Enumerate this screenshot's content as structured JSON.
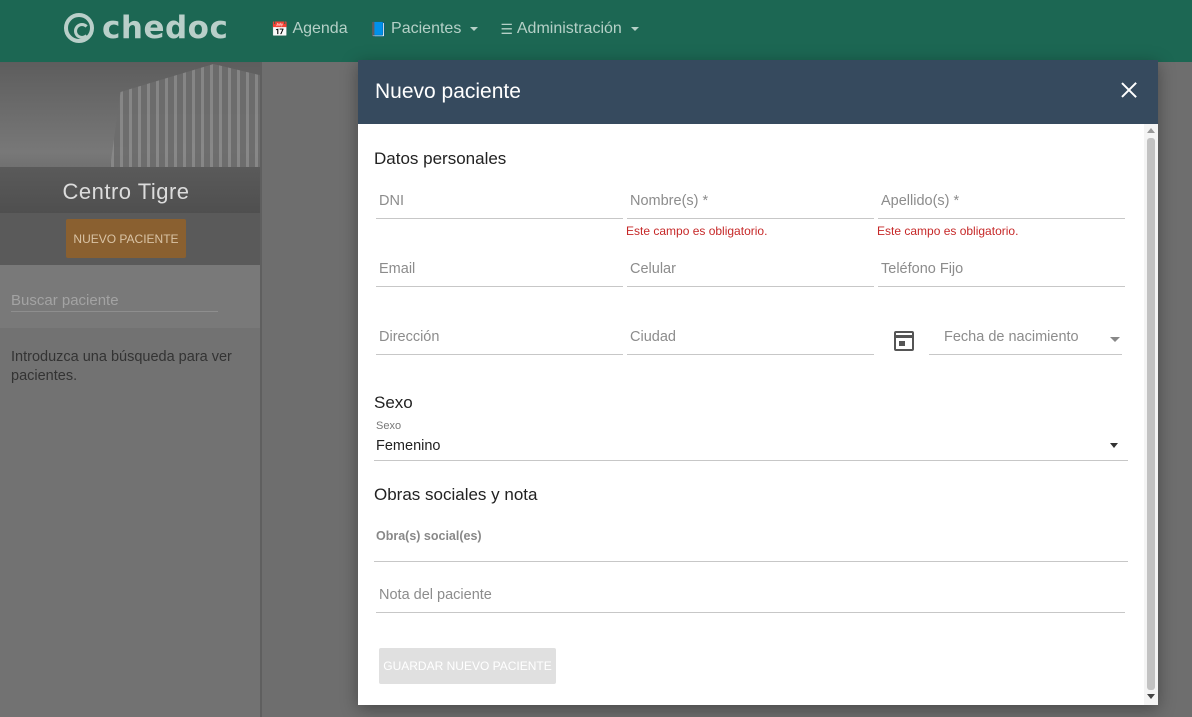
{
  "brand": {
    "name": "chedoc"
  },
  "nav": {
    "items": [
      {
        "label": "Agenda",
        "icon": "calendar-icon",
        "dropdown": false
      },
      {
        "label": "Pacientes",
        "icon": "book-icon",
        "dropdown": true
      },
      {
        "label": "Administración",
        "icon": "sliders-icon",
        "dropdown": true
      }
    ]
  },
  "sidebar": {
    "center_name": "Centro Tigre",
    "new_patient_label": "NUEVO PACIENTE",
    "search_placeholder": "Buscar paciente",
    "help_text": "Introduzca una búsqueda para ver pacientes."
  },
  "modal": {
    "title": "Nuevo paciente",
    "sections": {
      "personal": "Datos personales",
      "sex": "Sexo",
      "insurance": "Obras sociales y nota"
    },
    "fields": {
      "dni": {
        "placeholder": "DNI",
        "value": ""
      },
      "nombre": {
        "placeholder": "Nombre(s) *",
        "value": "",
        "error": "Este campo es obligatorio."
      },
      "apellido": {
        "placeholder": "Apellido(s) *",
        "value": "",
        "error": "Este campo es obligatorio."
      },
      "email": {
        "placeholder": "Email",
        "value": ""
      },
      "celular": {
        "placeholder": "Celular",
        "value": ""
      },
      "telefono": {
        "placeholder": "Teléfono Fijo",
        "value": ""
      },
      "direccion": {
        "placeholder": "Dirección",
        "value": ""
      },
      "ciudad": {
        "placeholder": "Ciudad",
        "value": ""
      },
      "fecha": {
        "placeholder": "Fecha de nacimiento",
        "value": ""
      },
      "nota": {
        "placeholder": "Nota del paciente",
        "value": ""
      }
    },
    "sex_select": {
      "label": "Sexo",
      "selected": "Femenino"
    },
    "obras_label": "Obra(s) social(es)",
    "save_label": "GUARDAR NUEVO PACIENTE"
  },
  "colors": {
    "navbar": "#1c6753",
    "modal_header": "#364a5e",
    "accent_button": "#8a6030",
    "error": "#c62828"
  }
}
